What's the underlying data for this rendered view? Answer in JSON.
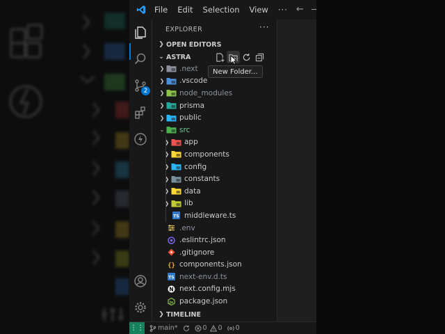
{
  "titlebar": {
    "menu": [
      "File",
      "Edit",
      "Selection",
      "View"
    ],
    "more": "···"
  },
  "activity": {
    "scm_badge": "2"
  },
  "explorer": {
    "title": "EXPLORER",
    "more": "···",
    "open_editors": "OPEN EDITORS",
    "project": "ASTRA",
    "tooltip": "New Folder...",
    "timeline": "TIMELINE"
  },
  "tree": [
    {
      "label": ".next",
      "depth": 0,
      "folder": true,
      "expanded": false,
      "color": "#8a8f99",
      "text_color": "#8b949e"
    },
    {
      "label": ".vscode",
      "depth": 0,
      "folder": true,
      "expanded": false,
      "color": "#4a90d9",
      "text_color": "#cccccc"
    },
    {
      "label": "node_modules",
      "depth": 0,
      "folder": true,
      "expanded": false,
      "color": "#8bc34a",
      "text_color": "#8b949e"
    },
    {
      "label": "prisma",
      "depth": 0,
      "folder": true,
      "expanded": false,
      "color": "#26a69a",
      "text_color": "#cccccc"
    },
    {
      "label": "public",
      "depth": 0,
      "folder": true,
      "expanded": false,
      "color": "#29b6f6",
      "text_color": "#cccccc"
    },
    {
      "label": "src",
      "depth": 0,
      "folder": true,
      "expanded": true,
      "color": "#4caf50",
      "text_color": "#73c991"
    },
    {
      "label": "app",
      "depth": 1,
      "folder": true,
      "expanded": false,
      "color": "#ef5350",
      "text_color": "#cccccc"
    },
    {
      "label": "components",
      "depth": 1,
      "folder": true,
      "expanded": false,
      "color": "#fdd835",
      "text_color": "#cccccc"
    },
    {
      "label": "config",
      "depth": 1,
      "folder": true,
      "expanded": false,
      "color": "#29b6f6",
      "text_color": "#cccccc"
    },
    {
      "label": "constants",
      "depth": 1,
      "folder": true,
      "expanded": false,
      "color": "#78909c",
      "text_color": "#cccccc"
    },
    {
      "label": "data",
      "depth": 1,
      "folder": true,
      "expanded": false,
      "color": "#fdd835",
      "text_color": "#cccccc"
    },
    {
      "label": "lib",
      "depth": 1,
      "folder": true,
      "expanded": false,
      "color": "#c0ca33",
      "text_color": "#cccccc"
    },
    {
      "label": "middleware.ts",
      "depth": 1,
      "folder": false,
      "icon": "ts",
      "color": "#3178c6",
      "text_color": "#cccccc"
    },
    {
      "label": ".env",
      "depth": 0,
      "folder": false,
      "icon": "env",
      "color": "#e0c060",
      "text_color": "#8b949e"
    },
    {
      "label": ".eslintrc.json",
      "depth": 0,
      "folder": false,
      "icon": "eslint",
      "color": "#7b68ee",
      "text_color": "#cccccc"
    },
    {
      "label": ".gitignore",
      "depth": 0,
      "folder": false,
      "icon": "git",
      "color": "#f05133",
      "text_color": "#cccccc"
    },
    {
      "label": "components.json",
      "depth": 0,
      "folder": false,
      "icon": "json",
      "color": "#f0b429",
      "text_color": "#cccccc"
    },
    {
      "label": "next-env.d.ts",
      "depth": 0,
      "folder": false,
      "icon": "ts",
      "color": "#3178c6",
      "text_color": "#8b949e"
    },
    {
      "label": "next.config.mjs",
      "depth": 0,
      "folder": false,
      "icon": "next",
      "color": "#ffffff",
      "text_color": "#cccccc"
    },
    {
      "label": "package.json",
      "depth": 0,
      "folder": false,
      "icon": "node",
      "color": "#8bc34a",
      "text_color": "#cccccc"
    }
  ],
  "status": {
    "branch": "main*",
    "errors": "0",
    "warnings": "0",
    "ports": "0"
  }
}
